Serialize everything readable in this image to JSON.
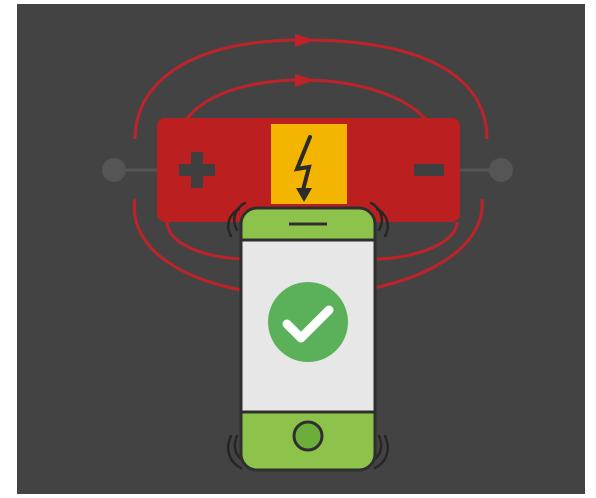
{
  "illustration": {
    "theme": {
      "background": "#434343",
      "page_background": "#ffffff",
      "field_line_color": "#c0222a",
      "battery_color": "#bb1f1f",
      "battery_symbol_color": "#3f3f3f",
      "terminal_color": "#555555",
      "hazard_label_color": "#f3b500",
      "phone_body_color": "#8dc34a",
      "phone_screen_color": "#e7e7e7",
      "phone_outline_color": "#2f2f2f",
      "check_badge_color": "#5bb05a",
      "check_mark_color": "#ffffff",
      "home_button_color": "#6dad3a"
    },
    "icons": {
      "battery": "battery-icon",
      "positive": "plus-icon",
      "negative": "minus-icon",
      "hazard": "lightning-bolt-icon",
      "status": "check-circle-icon",
      "device": "smartphone-icon"
    },
    "status": "success"
  }
}
